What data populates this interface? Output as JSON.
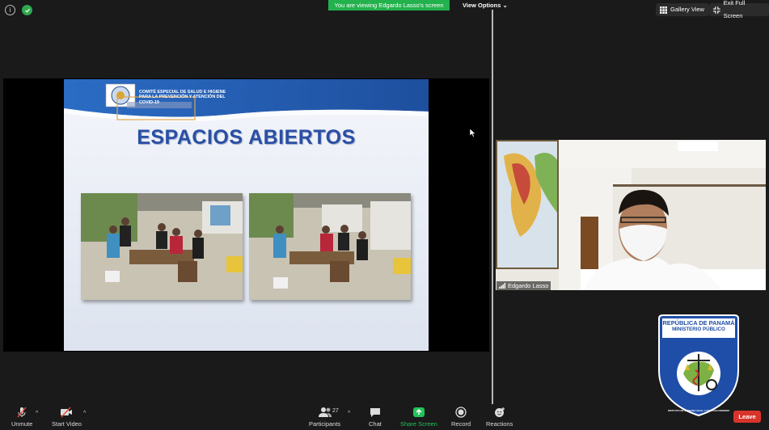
{
  "header": {
    "viewing_banner": "You are viewing Edgardo Lasso's screen",
    "view_options": "View Options",
    "gallery_view": "Gallery View",
    "exit_full_screen": "Exit Full Screen"
  },
  "slide": {
    "committee_lines": [
      "COMITÉ ESPECIAL DE SALUD E HIGIENE",
      "PARA LA PREVENCIÓN Y ATENCIÓN DEL",
      "COVID-19"
    ],
    "title": "ESPACIOS ABIERTOS"
  },
  "participant": {
    "name": "Edgardo Lasso"
  },
  "logo": {
    "line1": "REPÚBLICA DE PANAMÁ",
    "line2": "MINISTERIO PÚBLICO",
    "ring_text": "INSTITUTO DE MEDICINA LEGAL Y CIENCIAS FORENSES"
  },
  "toolbar": {
    "unmute": "Unmute",
    "start_video": "Start Video",
    "participants": "Participants",
    "participants_count": "27",
    "chat": "Chat",
    "share_screen": "Share Screen",
    "record": "Record",
    "reactions": "Reactions",
    "leave": "Leave"
  },
  "colors": {
    "zoom_green": "#23b14d",
    "leave_red": "#d9342b",
    "slide_title": "#2a4fa3"
  }
}
